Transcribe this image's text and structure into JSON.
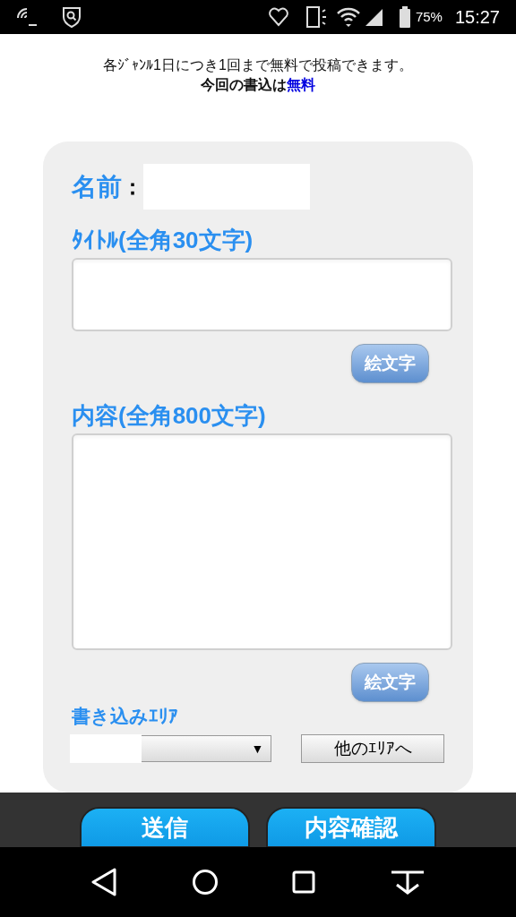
{
  "status_bar": {
    "battery": "75%",
    "time": "15:27"
  },
  "notice": {
    "line": "各ｼﾞｬﾝﾙ1日につき1回まで無料で投稿できます。",
    "status_prefix": "今回の書込は",
    "status_value": "無料"
  },
  "form": {
    "name_label": "名前",
    "name_separator": "：",
    "title_label": "ﾀｲﾄﾙ(全角30文字)",
    "title_emoji_button": "絵文字",
    "content_label": "内容(全角800文字)",
    "content_emoji_button": "絵文字",
    "area_label": "書き込みｴﾘｱ",
    "area_select_arrow": "▼",
    "other_area_button": "他のｴﾘｱへ"
  },
  "actions": [
    {
      "label": "送信"
    },
    {
      "label": "内容確認"
    }
  ]
}
